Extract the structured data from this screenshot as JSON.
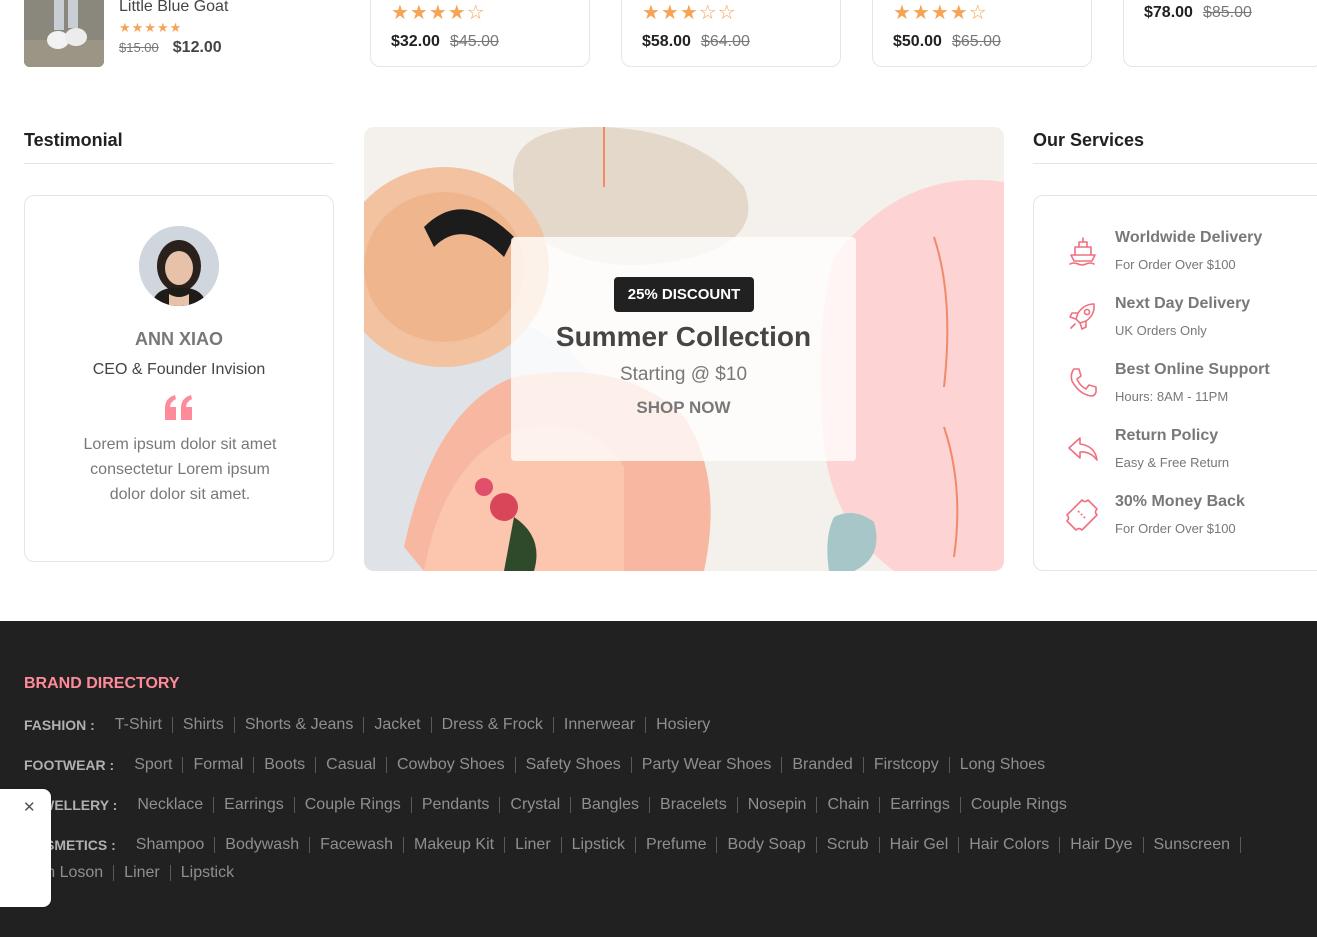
{
  "top_products": {
    "mini": {
      "title": "Little Blue Goat",
      "stars": "★★★★★",
      "old_price": "$15.00",
      "new_price": "$12.00"
    },
    "cards": [
      {
        "stars": "★★★★☆",
        "new_price": "$32.00",
        "old_price": "$45.00"
      },
      {
        "stars": "★★★☆☆",
        "new_price": "$58.00",
        "old_price": "$64.00"
      },
      {
        "stars": "★★★★☆",
        "new_price": "$50.00",
        "old_price": "$65.00"
      },
      {
        "stars": "",
        "new_price": "$78.00",
        "old_price": "$85.00"
      }
    ]
  },
  "testimonial": {
    "heading": "Testimonial",
    "name": "ANN XIAO",
    "role": "CEO & Founder Invision",
    "text": "Lorem ipsum dolor sit amet consectetur Lorem ipsum dolor dolor sit amet."
  },
  "banner": {
    "badge": "25% DISCOUNT",
    "title": "Summer Collection",
    "subtitle": "Starting @ $10",
    "cta": "SHOP NOW"
  },
  "services": {
    "heading": "Our Services",
    "items": [
      {
        "icon": "ship-icon",
        "title": "Worldwide Delivery",
        "subtitle": "For Order Over $100"
      },
      {
        "icon": "rocket-icon",
        "title": "Next Day Delivery",
        "subtitle": "UK Orders Only"
      },
      {
        "icon": "phone-icon",
        "title": "Best Online Support",
        "subtitle": "Hours: 8AM - 11PM"
      },
      {
        "icon": "arrow-undo-icon",
        "title": "Return Policy",
        "subtitle": "Easy & Free Return"
      },
      {
        "icon": "ticket-icon",
        "title": "30% Money Back",
        "subtitle": "For Order Over $100"
      }
    ]
  },
  "footer": {
    "directory_title": "BRAND DIRECTORY",
    "rows": [
      {
        "label": "FASHION :",
        "links": [
          "T-Shirt",
          "Shirts",
          "Shorts & Jeans",
          "Jacket",
          "Dress & Frock",
          "Innerwear",
          "Hosiery"
        ]
      },
      {
        "label": "FOOTWEAR :",
        "links": [
          "Sport",
          "Formal",
          "Boots",
          "Casual",
          "Cowboy Shoes",
          "Safety Shoes",
          "Party Wear Shoes",
          "Branded",
          "Firstcopy",
          "Long Shoes"
        ]
      },
      {
        "label": "JEWELLERY :",
        "links": [
          "Necklace",
          "Earrings",
          "Couple Rings",
          "Pendants",
          "Crystal",
          "Bangles",
          "Bracelets",
          "Nosepin",
          "Chain",
          "Earrings",
          "Couple Rings"
        ]
      },
      {
        "label": "COSMETICS :",
        "links": [
          "Shampoo",
          "Bodywash",
          "Facewash",
          "Makeup Kit",
          "Liner",
          "Lipstick",
          "Prefume",
          "Body Soap",
          "Scrub",
          "Hair Gel",
          "Hair Colors",
          "Hair Dye",
          "Sunscreen"
        ]
      },
      {
        "label": "",
        "links": [
          "Skin Loson",
          "Liner",
          "Lipstick"
        ]
      }
    ]
  },
  "popup": {
    "close": "✕"
  },
  "colors": {
    "accent_pink": "#ff8a9a",
    "star_orange": "#f6a355",
    "footer_bg": "#212121",
    "icon_pink": "#f0707f"
  }
}
